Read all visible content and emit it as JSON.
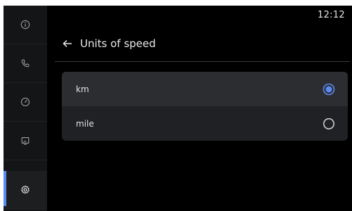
{
  "status": {
    "time": "12:12"
  },
  "rail": {
    "items": [
      {
        "icon": "info-icon"
      },
      {
        "icon": "phone-icon"
      },
      {
        "icon": "speedometer-icon"
      },
      {
        "icon": "display-icon"
      },
      {
        "icon": "gear-icon"
      }
    ],
    "active_index": 4,
    "accent_color": "#5c8bf3"
  },
  "page": {
    "title": "Units of speed"
  },
  "options": [
    {
      "label": "km",
      "selected": true
    },
    {
      "label": "mile",
      "selected": false
    }
  ]
}
